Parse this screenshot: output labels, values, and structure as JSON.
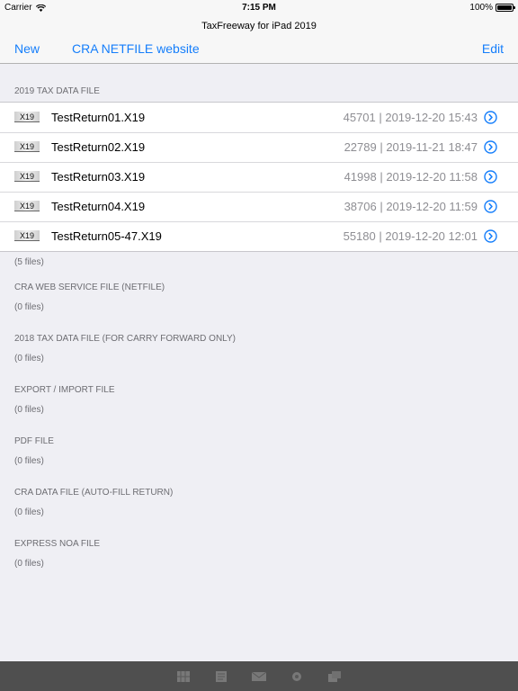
{
  "status_bar": {
    "carrier": "Carrier",
    "time": "7:15 PM",
    "battery": "100%"
  },
  "nav": {
    "title": "TaxFreeway for iPad 2019",
    "new_label": "New",
    "cra_label": "CRA NETFILE website",
    "edit_label": "Edit"
  },
  "sections": [
    {
      "header": "2019 TAX DATA FILE",
      "files": [
        {
          "icon_label": "X19",
          "name": "TestReturn01.X19",
          "meta": "45701 | 2019-12-20 15:43"
        },
        {
          "icon_label": "X19",
          "name": "TestReturn02.X19",
          "meta": "22789 | 2019-11-21 18:47"
        },
        {
          "icon_label": "X19",
          "name": "TestReturn03.X19",
          "meta": "41998 | 2019-12-20 11:58"
        },
        {
          "icon_label": "X19",
          "name": "TestReturn04.X19",
          "meta": "38706 | 2019-12-20 11:59"
        },
        {
          "icon_label": "X19",
          "name": "TestReturn05-47.X19",
          "meta": "55180 | 2019-12-20 12:01"
        }
      ],
      "count": "(5 files)"
    },
    {
      "header": "CRA WEB SERVICE FILE (NETFILE)",
      "count": "(0 files)"
    },
    {
      "header": "2018 TAX DATA FILE (FOR CARRY FORWARD ONLY)",
      "count": "(0 files)"
    },
    {
      "header": "EXPORT / IMPORT FILE",
      "count": "(0 files)"
    },
    {
      "header": "PDF FILE",
      "count": "(0 files)"
    },
    {
      "header": "CRA DATA FILE (AUTO-FILL RETURN)",
      "count": "(0 files)"
    },
    {
      "header": "EXPRESS NOA FILE",
      "count": "(0 files)"
    }
  ],
  "tab_bar": {
    "icons": [
      "grid-icon",
      "document-icon",
      "mail-icon",
      "settings-icon",
      "share-icon"
    ]
  },
  "colors": {
    "accent": "#157efb",
    "background": "#efeff4",
    "tab_bar": "#4f4f4f"
  }
}
